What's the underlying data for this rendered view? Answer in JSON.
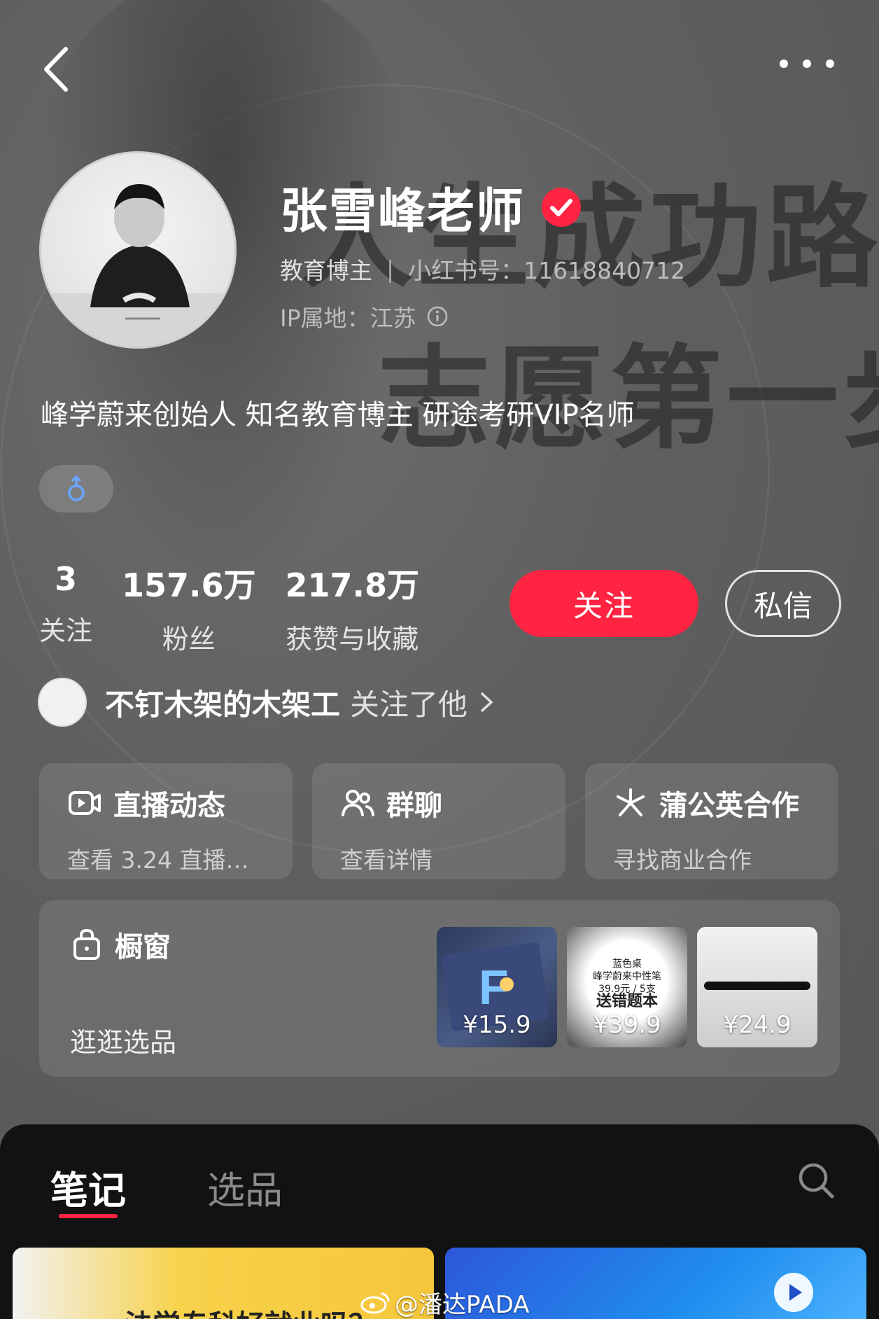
{
  "background": {
    "headline_line1": "人生成功路",
    "headline_line2": "志愿第一步"
  },
  "profile": {
    "name": "张雪峰老师",
    "role": "教育博主",
    "account_label": "小红书号：11618840712",
    "ip_location": "IP属地：江苏",
    "bio": "峰学蔚来创始人 知名教育博主 研途考研VIP名师",
    "gender_symbol": "♂"
  },
  "stats": [
    {
      "value": "3",
      "label": "关注"
    },
    {
      "value": "157.6万",
      "label": "粉丝"
    },
    {
      "value": "217.8万",
      "label": "获赞与收藏"
    }
  ],
  "actions": {
    "follow_label": "关注",
    "message_label": "私信"
  },
  "mutual": {
    "name": "不钉木架的木架工",
    "action": "关注了他"
  },
  "cards": [
    {
      "icon": "live-video-icon",
      "title": "直播动态",
      "subtitle": "查看 3.24 直播…"
    },
    {
      "icon": "group-chat-icon",
      "title": "群聊",
      "subtitle": "查看详情"
    },
    {
      "icon": "dandelion-icon",
      "title": "蒲公英合作",
      "subtitle": "寻找商业合作"
    }
  ],
  "shop": {
    "title": "橱窗",
    "browse_label": "逛逛选品",
    "products": [
      {
        "price": "¥15.9"
      },
      {
        "price": "¥39.9",
        "brand": "蓝色桌",
        "line1": "峰学蔚来中性笔",
        "line2": "39.9元 / 5支",
        "line3": "送错题本"
      },
      {
        "price": "¥24.9"
      }
    ]
  },
  "tabs": [
    {
      "label": "笔记",
      "active": true
    },
    {
      "label": "选品",
      "active": false
    }
  ],
  "feed": {
    "card1_text": "法学专科好就业吗？"
  },
  "watermark": "@潘达PADA",
  "colors": {
    "accent": "#ff2442",
    "panel": "#121212"
  }
}
